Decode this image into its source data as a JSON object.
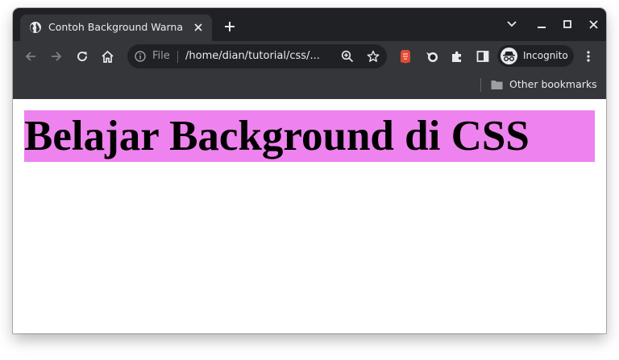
{
  "browser": {
    "tab": {
      "title": "Contoh Background Warna",
      "favicon": "globe-icon"
    },
    "new_tab_icon": "plus-icon",
    "window_controls": [
      "chevron-down-icon",
      "minimize-icon",
      "maximize-icon",
      "close-icon"
    ],
    "toolbar": {
      "back_icon": "arrow-left-icon",
      "forward_icon": "arrow-right-icon",
      "reload_icon": "reload-icon",
      "home_icon": "home-icon",
      "omnibox": {
        "scheme": "File",
        "url": "/home/dian/tutorial/css/..."
      },
      "zoom_icon": "zoom-icon",
      "bookmark_icon": "star-icon",
      "extensions": [
        "red-extension-icon",
        "bird-extension-icon",
        "puzzle-icon"
      ],
      "sidepanel_icon": "side-panel-icon",
      "profile": {
        "label": "Incognito",
        "icon": "incognito-icon"
      },
      "menu_icon": "kebab-menu-icon"
    },
    "bookmarks_bar": {
      "other_bookmarks": "Other bookmarks",
      "icon": "folder-icon"
    },
    "colors": {
      "tabstrip": "#202124",
      "toolbar": "#35363a",
      "text": "#e8eaed"
    }
  },
  "page": {
    "heading": "Belajar Background di CSS",
    "heading_background": "#ee82ee"
  }
}
